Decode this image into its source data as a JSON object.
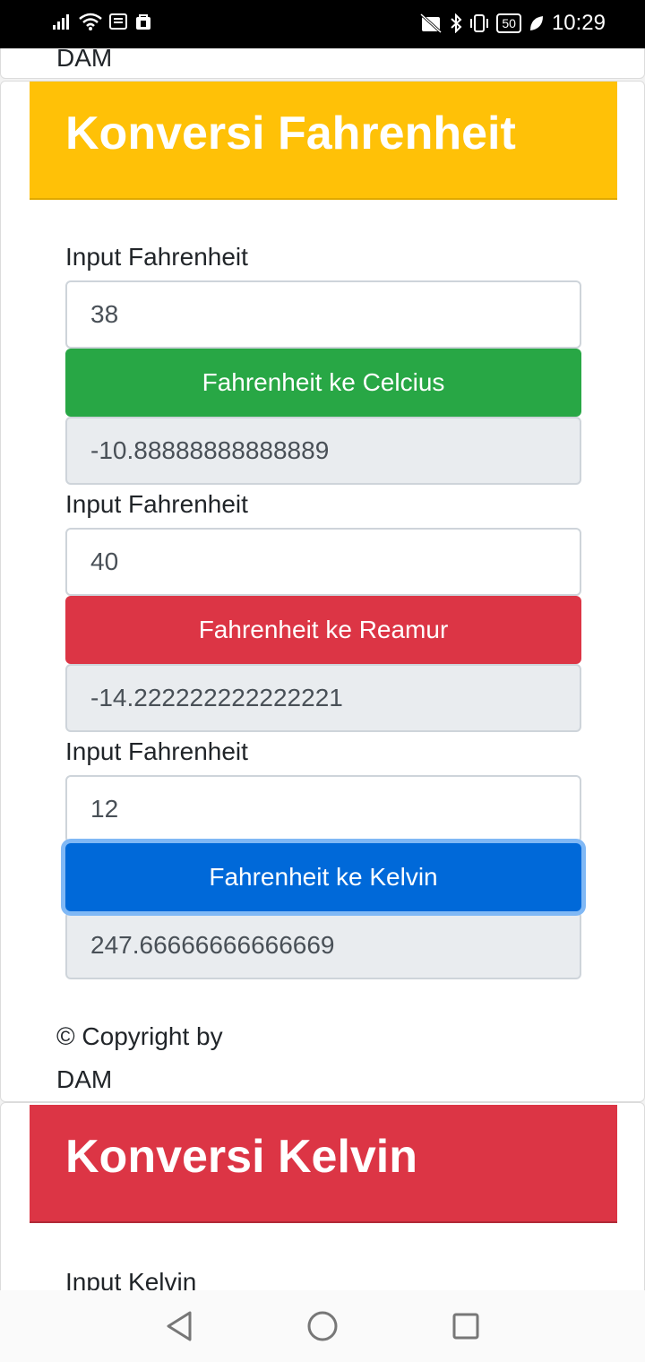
{
  "status_bar": {
    "time": "10:29",
    "battery": "50"
  },
  "previous_card": {
    "footer_tail": "DAM"
  },
  "fahrenheit_card": {
    "title": "Konversi Fahrenheit",
    "header_color": "#ffc107",
    "groups": [
      {
        "label": "Input Fahrenheit",
        "input_value": "38",
        "button_label": "Fahrenheit ke Celcius",
        "button_color": "#28a745",
        "result": "-10.88888888888889"
      },
      {
        "label": "Input Fahrenheit",
        "input_value": "40",
        "button_label": "Fahrenheit ke Reamur",
        "button_color": "#dc3545",
        "result": "-14.222222222222221"
      },
      {
        "label": "Input Fahrenheit",
        "input_value": "12",
        "button_label": "Fahrenheit ke Kelvin",
        "button_color": "#0069d9",
        "result": "247.66666666666669"
      }
    ],
    "footer_line1": "© Copyright by",
    "footer_line2": "DAM"
  },
  "kelvin_card": {
    "title": "Konversi Kelvin",
    "header_color": "#dc3545",
    "first_label": "Input Kelvin"
  },
  "nav_bar": {
    "icons": [
      "back-icon",
      "home-icon",
      "recents-icon"
    ]
  }
}
